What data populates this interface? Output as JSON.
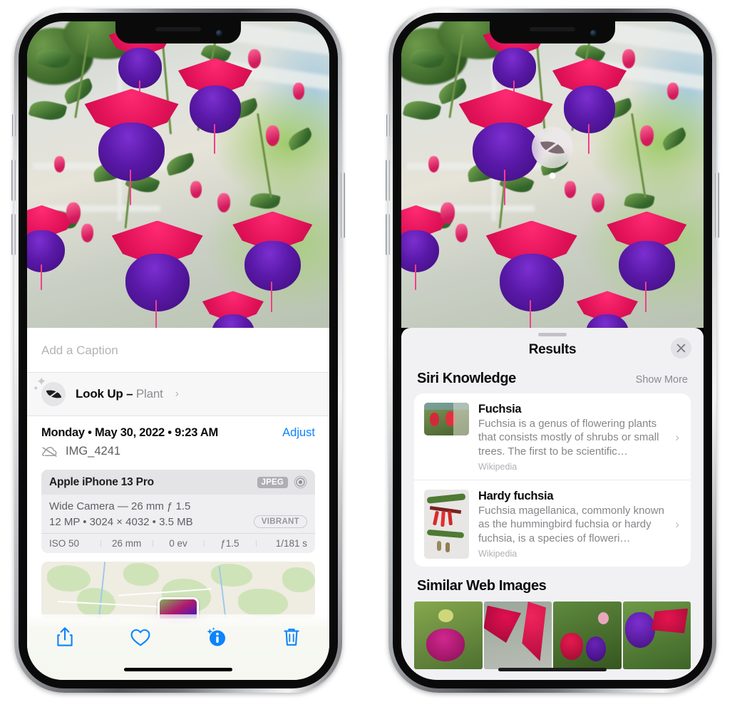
{
  "left_phone": {
    "caption": {
      "placeholder": "Add a Caption"
    },
    "look_up": {
      "label": "Look Up",
      "dash": " – ",
      "kind": "Plant",
      "chevron": "›",
      "icon": "leaf-icon"
    },
    "metadata": {
      "date": "Monday • May 30, 2022 • 9:23 AM",
      "adjust_label": "Adjust",
      "filename": "IMG_4241",
      "cloud_icon": "cloud-slash-icon"
    },
    "exif": {
      "device": "Apple iPhone 13 Pro",
      "format_tag": "JPEG",
      "aperture_icon": "aperture-icon",
      "lens": "Wide Camera — 26 mm ƒ 1.5",
      "size_line": "12 MP • 3024 × 4032 • 3.5 MB",
      "style_tag": "VIBRANT",
      "stats": [
        "ISO 50",
        "26 mm",
        "0 ev",
        "ƒ1.5",
        "1/181 s"
      ]
    },
    "toolbar": [
      {
        "name": "share-button",
        "icon": "share-icon"
      },
      {
        "name": "favorite-button",
        "icon": "heart-icon"
      },
      {
        "name": "info-button",
        "icon": "info-sparkle-icon"
      },
      {
        "name": "delete-button",
        "icon": "trash-icon"
      }
    ],
    "accent": "#0a84ff"
  },
  "right_phone": {
    "visual_lookup_badge": {
      "icon": "leaf-icon"
    },
    "sheet": {
      "title": "Results",
      "close_label": "✕"
    },
    "siri_knowledge": {
      "title": "Siri Knowledge",
      "show_more": "Show More",
      "items": [
        {
          "title": "Fuchsia",
          "description": "Fuchsia is a genus of flowering plants that consists mostly of shrubs or small trees. The first to be scientific…",
          "source": "Wikipedia",
          "chevron": "›"
        },
        {
          "title": "Hardy fuchsia",
          "description": "Fuchsia magellanica, commonly known as the hummingbird fuchsia or hardy fuchsia, is a species of floweri…",
          "source": "Wikipedia",
          "chevron": "›"
        }
      ]
    },
    "similar_web_images": {
      "title": "Similar Web Images",
      "count": 4
    }
  }
}
